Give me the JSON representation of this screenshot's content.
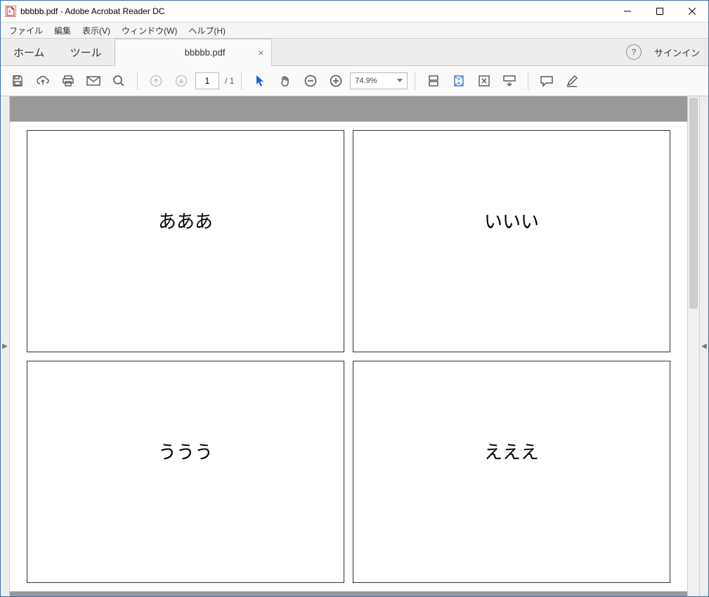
{
  "window": {
    "title": "bbbbb.pdf - Adobe Acrobat Reader DC"
  },
  "menu": {
    "file": "ファイル",
    "edit": "編集",
    "view": "表示(V)",
    "window": "ウィンドウ(W)",
    "help": "ヘルプ(H)"
  },
  "tabs": {
    "home": "ホーム",
    "tools": "ツール",
    "document": "bbbbb.pdf"
  },
  "header": {
    "signin": "サインイン"
  },
  "toolbar": {
    "page_current": "1",
    "page_total": "/ 1",
    "zoom_value": "74.9%"
  },
  "document": {
    "cells": {
      "top_left": "あああ",
      "top_right": "いいい",
      "bottom_left": "ううう",
      "bottom_right": "えええ"
    }
  }
}
